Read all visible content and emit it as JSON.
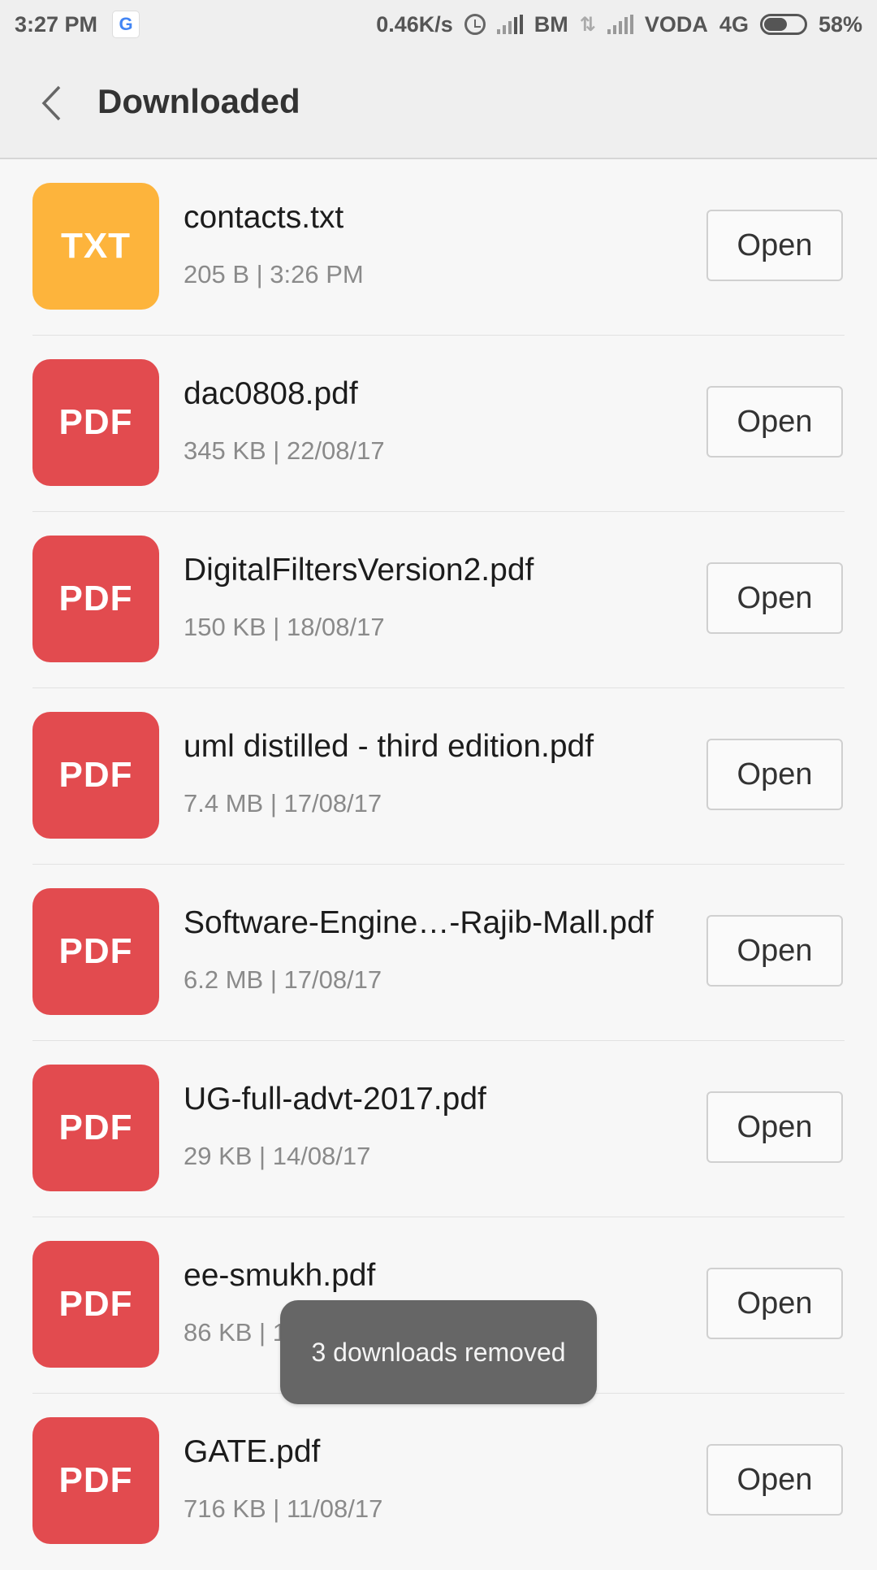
{
  "status_bar": {
    "time": "3:27 PM",
    "google_icon": "G",
    "speed": "0.46K/s",
    "sim1": "BM",
    "sim2": "VODA",
    "network": "4G",
    "battery": "58%",
    "battery_level": 0.58
  },
  "header": {
    "title": "Downloaded"
  },
  "downloads": [
    {
      "type": "TXT",
      "color": "#fdb43c",
      "name": "contacts.txt",
      "meta": "205 B | 3:26 PM",
      "action": "Open"
    },
    {
      "type": "PDF",
      "color": "#e24b4f",
      "name": "dac0808.pdf",
      "meta": "345 KB | 22/08/17",
      "action": "Open"
    },
    {
      "type": "PDF",
      "color": "#e24b4f",
      "name": "DigitalFiltersVersion2.pdf",
      "meta": "150 KB | 18/08/17",
      "action": "Open"
    },
    {
      "type": "PDF",
      "color": "#e24b4f",
      "name": "uml distilled - third edition.pdf",
      "meta": "7.4 MB | 17/08/17",
      "action": "Open"
    },
    {
      "type": "PDF",
      "color": "#e24b4f",
      "name": "Software-Engine…-Rajib-Mall.pdf",
      "meta": "6.2 MB | 17/08/17",
      "action": "Open"
    },
    {
      "type": "PDF",
      "color": "#e24b4f",
      "name": "UG-full-advt-2017.pdf",
      "meta": "29 KB | 14/08/17",
      "action": "Open"
    },
    {
      "type": "PDF",
      "color": "#e24b4f",
      "name": "ee-smukh.pdf",
      "meta": "86 KB | 13/08/17",
      "action": "Open"
    },
    {
      "type": "PDF",
      "color": "#e24b4f",
      "name": "GATE.pdf",
      "meta": "716 KB | 11/08/17",
      "action": "Open"
    }
  ],
  "toast": {
    "message": "3 downloads removed"
  }
}
